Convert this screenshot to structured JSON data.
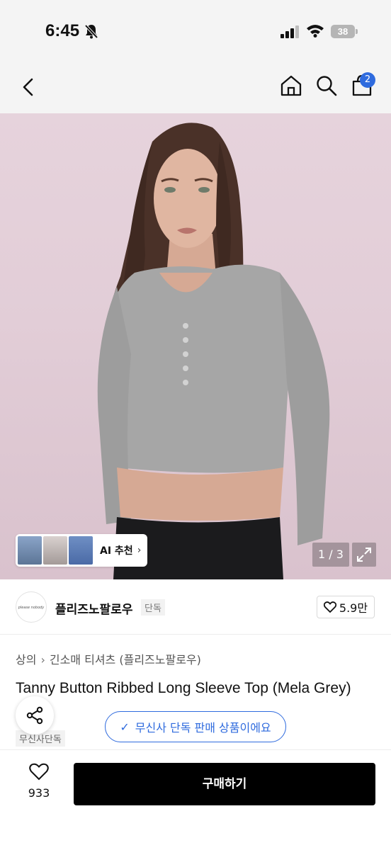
{
  "status_bar": {
    "time": "6:45",
    "battery": "38"
  },
  "nav": {
    "cart_count": "2"
  },
  "hero": {
    "ai_recommend_label": "AI 추천",
    "pager": "1 / 3"
  },
  "brand": {
    "logo_text": "please nobody",
    "name": "플리즈노팔로우",
    "tag": "단독",
    "likes": "5.9만"
  },
  "product": {
    "breadcrumb": [
      "상의",
      "긴소매 티셔츠 (플리즈노팔로우)"
    ],
    "title": "Tanny Button Ribbed Long Sleeve Top (Mela    Grey)",
    "exclusive_tag": "무신사단독",
    "exclusive_notice": "무신사 단독 판매 상품이에요"
  },
  "bottom_bar": {
    "wishlist_count": "933",
    "buy_label": "구매하기"
  },
  "colors": {
    "accent": "#2f6bde",
    "buy_button": "#000000"
  }
}
